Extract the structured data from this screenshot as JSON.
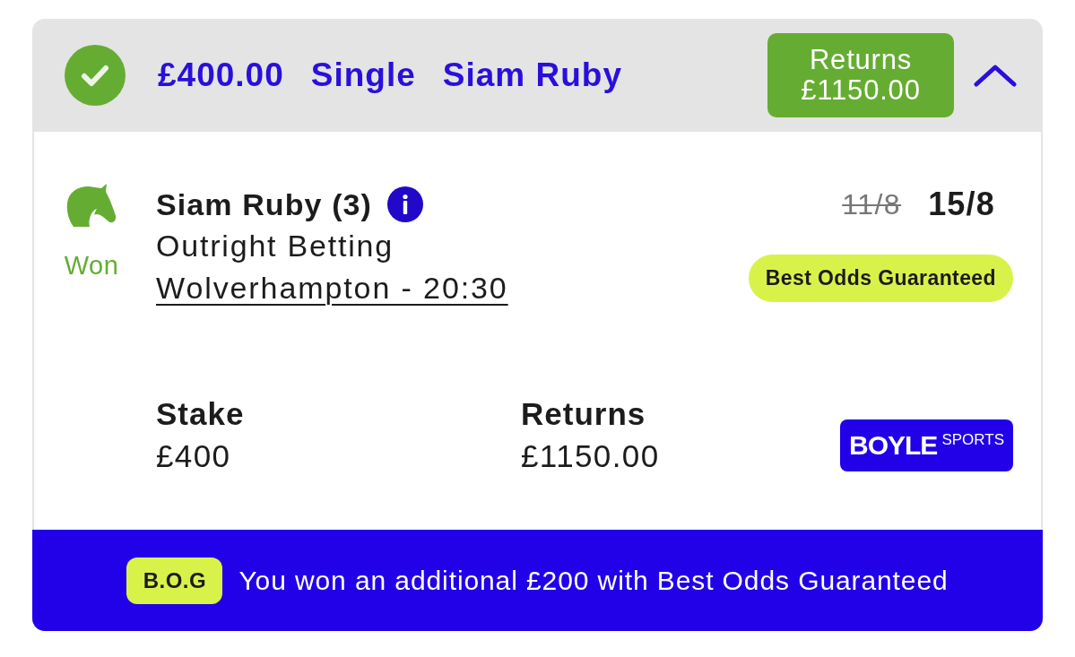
{
  "bet_header": {
    "won": true,
    "stake": "£400.00",
    "bet_type": "Single",
    "selection": "Siam Ruby",
    "returns_button": {
      "label": "Returns",
      "amount": "£1150.00"
    },
    "expanded": true
  },
  "selection": {
    "result": "Won",
    "name": "Siam Ruby (3)",
    "market": "Outright Betting",
    "event": "Wolverhampton - 20:30",
    "previous_odds": "11/8",
    "odds": "15/8",
    "badge": "Best Odds Guaranteed"
  },
  "summary": [
    {
      "label": "Stake",
      "value": "£400"
    },
    {
      "label": "Returns",
      "value": "£1150.00"
    }
  ],
  "logo": {
    "wordmark": "BOYLE",
    "suffix": "SPORTS"
  },
  "footer": {
    "badge": "B.O.G",
    "message": "You won an additional £200 with Best Odds Guaranteed"
  }
}
